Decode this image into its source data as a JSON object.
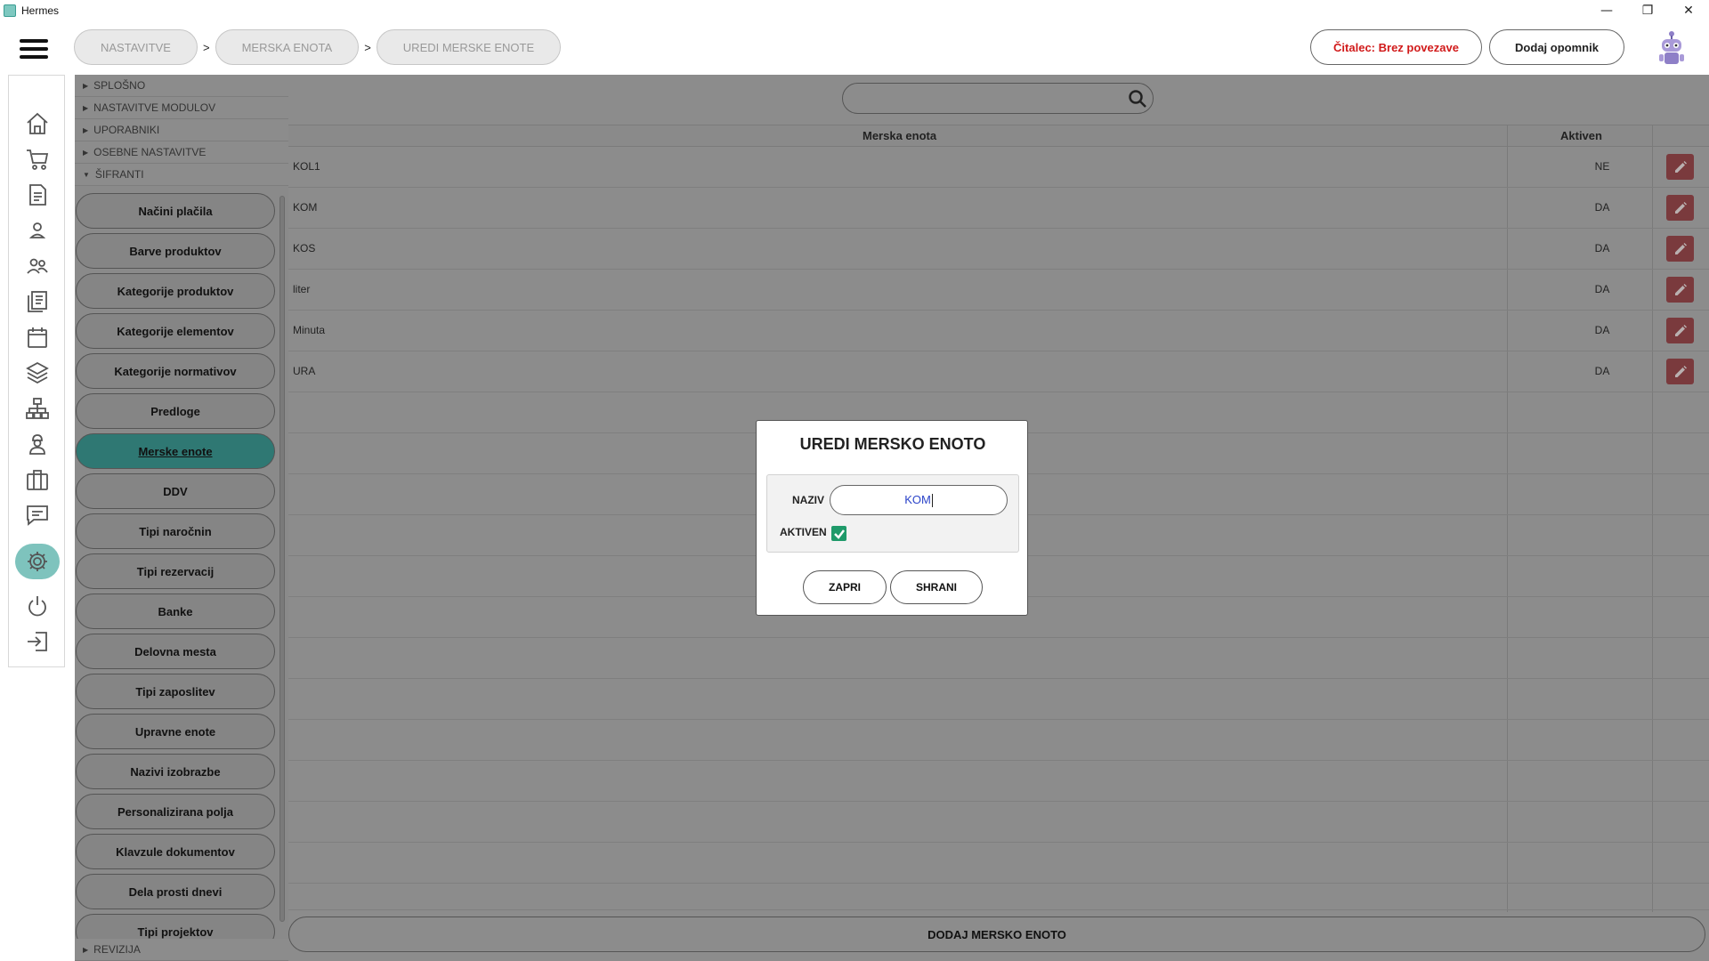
{
  "window": {
    "title": "Hermes",
    "controls": [
      "—",
      "❐",
      "✕"
    ]
  },
  "breadcrumbs": [
    "NASTAVITVE",
    "MERSKA ENOTA",
    "UREDI MERSKE ENOTE"
  ],
  "breadcrumb_sep": ">",
  "header": {
    "reader_label": "Čitalec: Brez povezave",
    "reminder_label": "Dodaj opomnik"
  },
  "rail_icons": [
    "home-icon",
    "cart-icon",
    "invoice-icon",
    "person-icon",
    "people-icon",
    "documents-icon",
    "calendar-icon",
    "layers-icon",
    "org-chart-icon",
    "worker-icon",
    "briefcase-icon",
    "chat-icon",
    "settings-icon",
    "power-icon",
    "logout-icon"
  ],
  "tree": {
    "sections": [
      "SPLOŠNO",
      "NASTAVITVE MODULOV",
      "UPORABNIKI",
      "OSEBNE NASTAVITVE",
      "ŠIFRANTI"
    ],
    "items": [
      "Načini plačila",
      "Barve produktov",
      "Kategorije produktov",
      "Kategorije elementov",
      "Kategorije normativov",
      "Predloge",
      "Merske enote",
      "DDV",
      "Tipi naročnin",
      "Tipi rezervacij",
      "Banke",
      "Delovna mesta",
      "Tipi zaposlitev",
      "Upravne enote",
      "Nazivi izobrazbe",
      "Personalizirana polja",
      "Klavzule dokumentov",
      "Dela prosti dnevi",
      "Tipi projektov"
    ],
    "selected": "Merske enote",
    "bottom_section": "REVIZIJA"
  },
  "grid": {
    "columns": [
      "Merska enota",
      "Aktiven"
    ],
    "rows": [
      {
        "name": "KOL1",
        "active": "NE"
      },
      {
        "name": "KOM",
        "active": "DA"
      },
      {
        "name": "KOS",
        "active": "DA"
      },
      {
        "name": "liter",
        "active": "DA"
      },
      {
        "name": "Minuta",
        "active": "DA"
      },
      {
        "name": "URA",
        "active": "DA"
      }
    ],
    "add_label": "DODAJ MERSKO ENOTO"
  },
  "modal": {
    "title": "UREDI MERSKO ENOTO",
    "name_label": "NAZIV",
    "name_value": "KOM",
    "active_label": "AKTIVEN",
    "active_checked": true,
    "close_label": "ZAPRI",
    "save_label": "SHRANI"
  },
  "colors": {
    "accent": "#2f7873",
    "reader_red": "#d11a1a",
    "edit_button": "#7a3a3d",
    "checkbox": "#1f9a6a"
  }
}
